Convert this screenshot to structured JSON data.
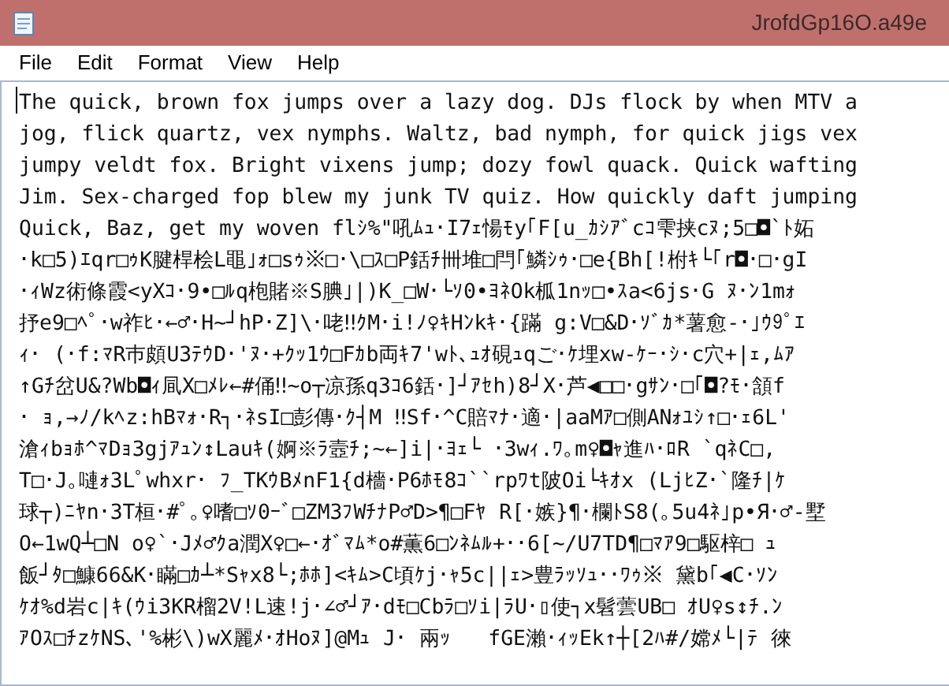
{
  "window": {
    "title": "JrofdGp16O.a49e"
  },
  "menu": [
    "File",
    "Edit",
    "Format",
    "View",
    "Help"
  ],
  "editor": {
    "lines": [
      "The quick, brown fox jumps over a lazy dog. DJs flock by when MTV a",
      "jog, flick quartz, vex nymphs. Waltz, bad nymph, for quick jigs vex",
      "jumpy veldt fox. Bright vixens jump; dozy fowl quack. Quick wafting",
      "Jim. Sex-charged fop blew my junk TV quiz. How quickly daft jumping",
      "Quick, Baz, get my woven flｼ%\"吼ﾑｭ･I7ｪ愓ﾓy｢F[u_ｶｼｱﾞcｺ雫挟cﾇ;5□◘`ﾄ妬",
      "･k□5)ｴqr□ｩK腱桿桧L黽｣ｫ□sｩ※□･\\□ｽ□P銛ﾁ卌堆□閂｢鱗ｼｩ･□e{Bh[!柎ｷ└｢r◘･□･gI",
      "･ｨWz術條霞<yXｺ･9•□ﾙq枹賭※S腆｣|)K_□W･└ｿ0•ﾖﾈOk柧1nｯ□•ｽa<6js･G ﾇ･ﾝ1mｫ",
      "抒e9□ﾍﾟ･w祚ﾋ･←♂･H~┘hP･Z]\\･咾‼ｸM･i!ﾉ♀ｷHﾝkｷ･{蹣 g:V□&D･ｿﾞｶ*薯愈-･｣ｳ9ﾟｴ",
      "ｨ･ (･f:ﾏR巿頗U3ﾃｳD･'ﾇ･+ｸｯ1ｳ□Fｶb両ｷ7'wﾄ､ｭｵ硯ｭqご･ｹ埋xw-ｹｰ･ｼ･c穴+|ｪ,ﾑｱ",
      "↑Gﾁ岔U&?Wb◘ｨ凬X□ﾒﾚ←#俑‼~o┬凉孫q3ｺ6銛･]┘ｱｾh)8┘X･芦◀□□･gｻﾝ･□｢◘?ﾓ･頷f",
      "･ ｮ,→ﾉ/kﾍz:hBﾏｫ･R┐･ﾈsI□彭傳･ｸ┤M ‼Sf･^C賠ﾏﾅ･適･|aaMｱ□側ANｫﾕｼ↑□･ｪ6L'",
      "滄ｨbｮﾎ^ﾏDｮ3gjｱｭﾝ↕Lauｷ(婀※ﾗ壼ﾁ;~←]i|･ﾖｪ└ ･3wｨ.ﾜ｡m♀◘ｬ進ﾊ･ﾛR `qﾈC□,",
      "T□･J｡嗹ｫ3Lﾟwhxr･ ﾌ_TKｳBﾒnF1{d檣･P6ﾎﾓ8ｺ``rpﾜt陂Oi└ｷｵx (LjﾋZ･`隆ﾁ|ｹ",
      "球┬)ﾆﾔn･3T桓･#ﾟ｡♀嗜□ｿ0-ﾞ□ZM3ﾌWﾁﾅP♂D>¶□Fﾔ R[･嫉}¶･欄ﾄS8(｡5u4ﾈ｣p•Я･♂-墅",
      "O←1wQ┴□N o♀`･Jﾒ♂ｸa潤X♀□←･ｵﾞﾏﾑ*o#薫6□ﾝﾈﾑﾙ+･･6[~/U7TD¶□ﾏｱ9□駆梓□ ｭ",
      "飯┘ﾀ□鱇66&K･瞞□ｶ┴*Sｬx8└;ﾎﾎ]<ｷﾑ>C頃ｹj･ｬ5c||ｪ>豊ﾗｯｿｭ･･ﾜｩ※ 黛b｢◀C･ｿﾝ",
      "ｹｵ%d岩c|ｷ(ｳi3KR榴2V!L速!j･∠♂┘ｱ･dﾓ□Cbﾗ□ｿi|ﾗU･▯使┐x髫蕓UB□ ｵU♀s↕ﾁ.ﾝ",
      "ｱOｽ□ﾁzｹNS､'%彬\\)wX麗ﾒ･ｵHoﾇ]@Mｭ J･ 兩ｯ   fGE瀨･ｨｯEk↑┼[2ﾊ#/嫦ﾒ└|ﾃ 徠"
    ]
  }
}
